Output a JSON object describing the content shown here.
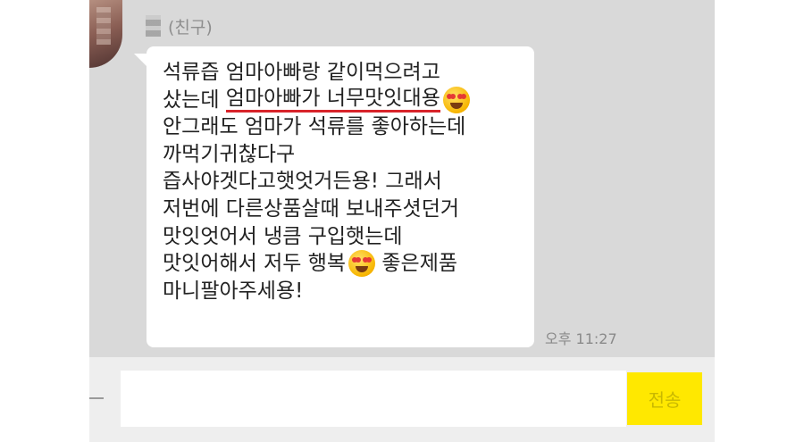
{
  "chat": {
    "sender": {
      "name_suffix": "(친구)",
      "avatar_icon": "profile-avatar-blurred",
      "name_redacted": true
    },
    "message": {
      "lines": [
        "석류즙 엄마아빠랑 같이먹으려고",
        "샀는데 ",
        "엄마아빠가 너무맛잇대용",
        "안그래도 엄마가 석류를 좋아하는데",
        "까먹기귀찮다구",
        "즙사야겟다고햇엇거든용! 그래서",
        "저번에 다른상품살때 보내주셧던거",
        "맛잇엇어서 냉큼 구입햇는데",
        "맛잇어해서 저두 행복",
        " 좋은제품",
        "마니팔아주세용!"
      ],
      "highlight_color": "#d8232a",
      "emoji_icon": "heart-eyes-emoji"
    },
    "timestamp": "오후 11:27"
  },
  "input": {
    "value": "",
    "placeholder": "",
    "send_label": "전송",
    "send_color": "#ffe800"
  }
}
